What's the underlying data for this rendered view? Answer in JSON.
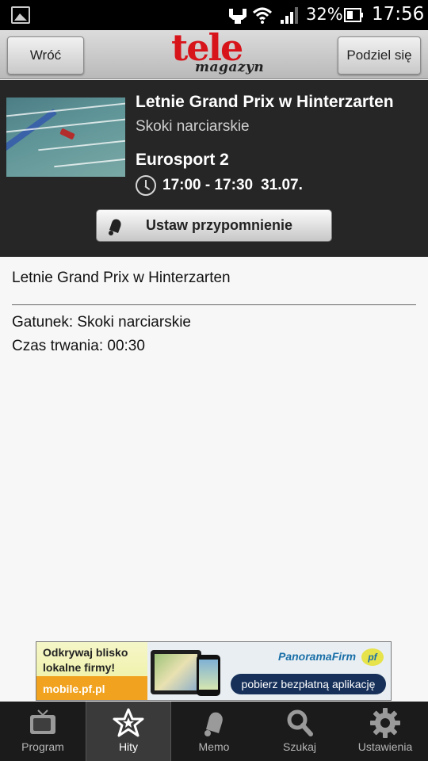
{
  "status_bar": {
    "battery_percent": "32%",
    "time": "17:56",
    "icons": [
      "gallery-icon",
      "usb-icon",
      "wifi-icon",
      "signal-icon",
      "battery-icon"
    ]
  },
  "header": {
    "back_label": "Wróć",
    "share_label": "Podziel się",
    "logo_top": "tele",
    "logo_bottom": "magazyn",
    "logo_color": "#d8141b"
  },
  "program": {
    "title": "Letnie Grand Prix w Hinterzarten",
    "genre": "Skoki narciarskie",
    "channel": "Eurosport 2",
    "time_range": "17:00 - 17:30",
    "date": "31.07.",
    "reminder_label": "Ustaw przypomnienie"
  },
  "details": {
    "title": "Letnie Grand Prix w Hinterzarten",
    "genre_line": "Gatunek: Skoki narciarskie",
    "duration_line": "Czas trwania: 00:30"
  },
  "ad": {
    "headline_line1": "Odkrywaj blisko",
    "headline_line2": "lokalne firmy!",
    "url": "mobile.pf.pl",
    "brand": "PanoramaFirm",
    "brand_badge": "pf",
    "cta": "pobierz bezpłatną aplikację"
  },
  "nav": {
    "items": [
      {
        "label": "Program",
        "icon": "tv-icon"
      },
      {
        "label": "Hity",
        "icon": "star-icon",
        "active": true
      },
      {
        "label": "Memo",
        "icon": "bell-icon"
      },
      {
        "label": "Szukaj",
        "icon": "search-icon"
      },
      {
        "label": "Ustawienia",
        "icon": "gear-icon"
      }
    ]
  }
}
